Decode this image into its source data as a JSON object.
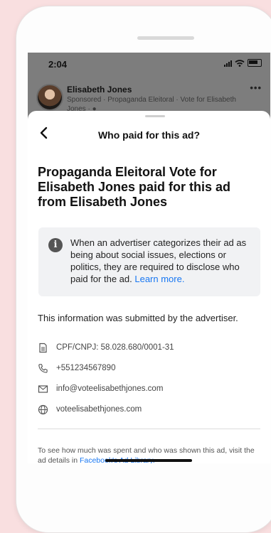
{
  "status_bar": {
    "time": "2:04"
  },
  "post": {
    "author": "Elisabeth Jones",
    "subtitle": "Sponsored · Propaganda Eleitoral · Vote for Elisabeth Jones · ●",
    "more": "•••"
  },
  "sheet": {
    "title": "Who paid for this ad?",
    "headline": "Propaganda Eleitoral Vote for Elisabeth Jones paid for this ad from Elisabeth Jones",
    "info_text": "When an advertiser categorizes their ad as being about social issues, elections or politics, they are required to disclose who paid for the ad.",
    "info_link": "Learn more.",
    "submitted_note": "This information was submitted by the advertiser.",
    "details": [
      {
        "icon": "document-icon",
        "text": "CPF/CNPJ: 58.028.680/0001-31"
      },
      {
        "icon": "phone-icon",
        "text": "+551234567890"
      },
      {
        "icon": "envelope-icon",
        "text": "info@voteelisabethjones.com"
      },
      {
        "icon": "globe-icon",
        "text": "voteelisabethjones.com"
      }
    ],
    "footer_text": "To see how much was spent and who was shown this ad, visit the ad details in",
    "footer_link": "Facebook's Ad Library."
  },
  "colors": {
    "background": "#f9dfe0",
    "link": "#1877f2",
    "info_bg": "#f1f2f4"
  }
}
